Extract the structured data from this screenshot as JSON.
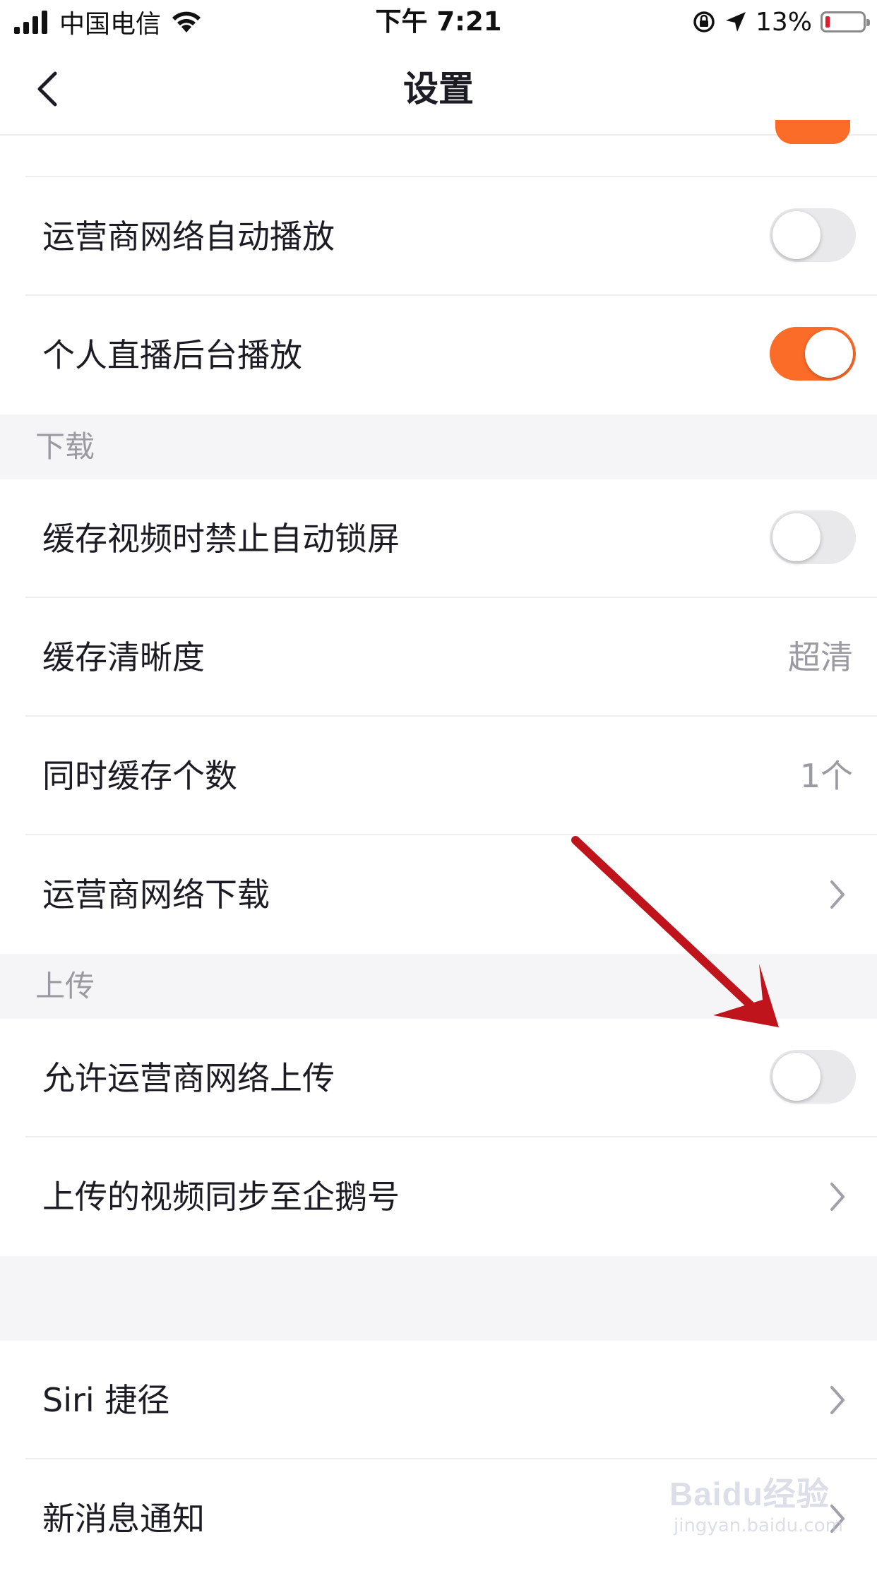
{
  "status_bar": {
    "carrier": "中国电信",
    "time": "下午 7:21",
    "battery_percent": "13%",
    "battery_color": "#e8192c"
  },
  "nav": {
    "title": "设置",
    "back_icon": "chevron-left-icon"
  },
  "accent_color": "#fc6c29",
  "rows_top": [
    {
      "label": "运营商网络自动播放",
      "toggle": false
    },
    {
      "label": "个人直播后台播放",
      "toggle": true
    }
  ],
  "download_section": {
    "title": "下载",
    "rows": [
      {
        "label": "缓存视频时禁止自动锁屏",
        "toggle": false
      },
      {
        "label": "缓存清晰度",
        "value": "超清"
      },
      {
        "label": "同时缓存个数",
        "value": "1个"
      },
      {
        "label": "运营商网络下载",
        "chevron": true
      }
    ]
  },
  "upload_section": {
    "title": "上传",
    "rows": [
      {
        "label": "允许运营商网络上传",
        "toggle": false
      },
      {
        "label": "上传的视频同步至企鹅号",
        "chevron": true
      }
    ]
  },
  "other_rows": [
    {
      "label": "Siri 捷径",
      "chevron": true
    },
    {
      "label": "新消息通知",
      "chevron": true
    }
  ],
  "annotation": {
    "arrow_color": "#c0141c"
  },
  "watermark": {
    "brand": "Baidu经验",
    "url": "jingyan.baidu.com"
  }
}
